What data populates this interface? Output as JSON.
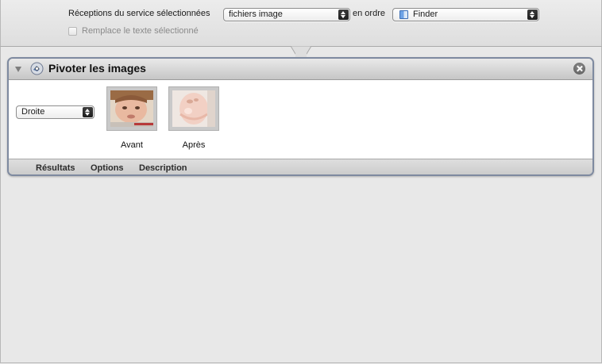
{
  "service_bar": {
    "receives_label": "Réceptions du service sélectionnées",
    "input_type": "fichiers image",
    "in_label": "en ordre",
    "application": "Finder",
    "replace_checkbox_label": "Remplace le texte sélectionné",
    "replace_checked": false
  },
  "action": {
    "title": "Pivoter les images",
    "direction": "Droite",
    "before_caption": "Avant",
    "after_caption": "Après",
    "tabs": [
      "Résultats",
      "Options",
      "Description"
    ]
  },
  "colors": {
    "panel_border": "#7e8aa0",
    "header_gradient_top": "#e9e9e9",
    "header_gradient_bottom": "#c6c6c6"
  }
}
